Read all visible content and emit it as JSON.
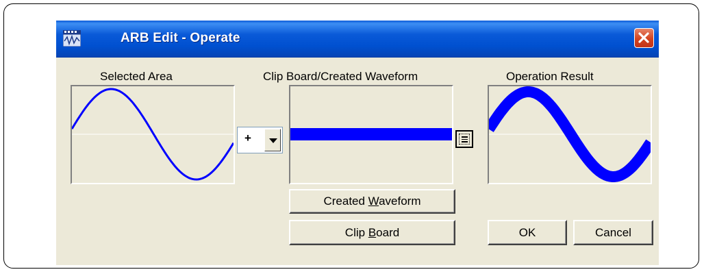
{
  "window": {
    "title": "ARB Edit - Operate",
    "app_icon": "waveform-app-icon",
    "close_icon": "close-x-icon"
  },
  "panels": {
    "selected_area": {
      "label": "Selected Area"
    },
    "clipboard": {
      "label": "Clip Board/Created Waveform"
    },
    "result": {
      "label": "Operation Result"
    }
  },
  "operator_select": {
    "value": "+",
    "dropdown_icon": "chevron-down-icon"
  },
  "list_button": {
    "icon": "list-icon"
  },
  "buttons": {
    "created_waveform": {
      "before": "Created ",
      "mnemonic": "W",
      "after": "aveform"
    },
    "clip_board": {
      "before": "Clip ",
      "mnemonic": "B",
      "after": "oard"
    },
    "ok": "OK",
    "cancel": "Cancel"
  },
  "colors": {
    "waveform": "#0000ff",
    "titlebar": "#0a5ad8",
    "close_button": "#d4431e",
    "dialog_bg": "#ece9d8"
  }
}
